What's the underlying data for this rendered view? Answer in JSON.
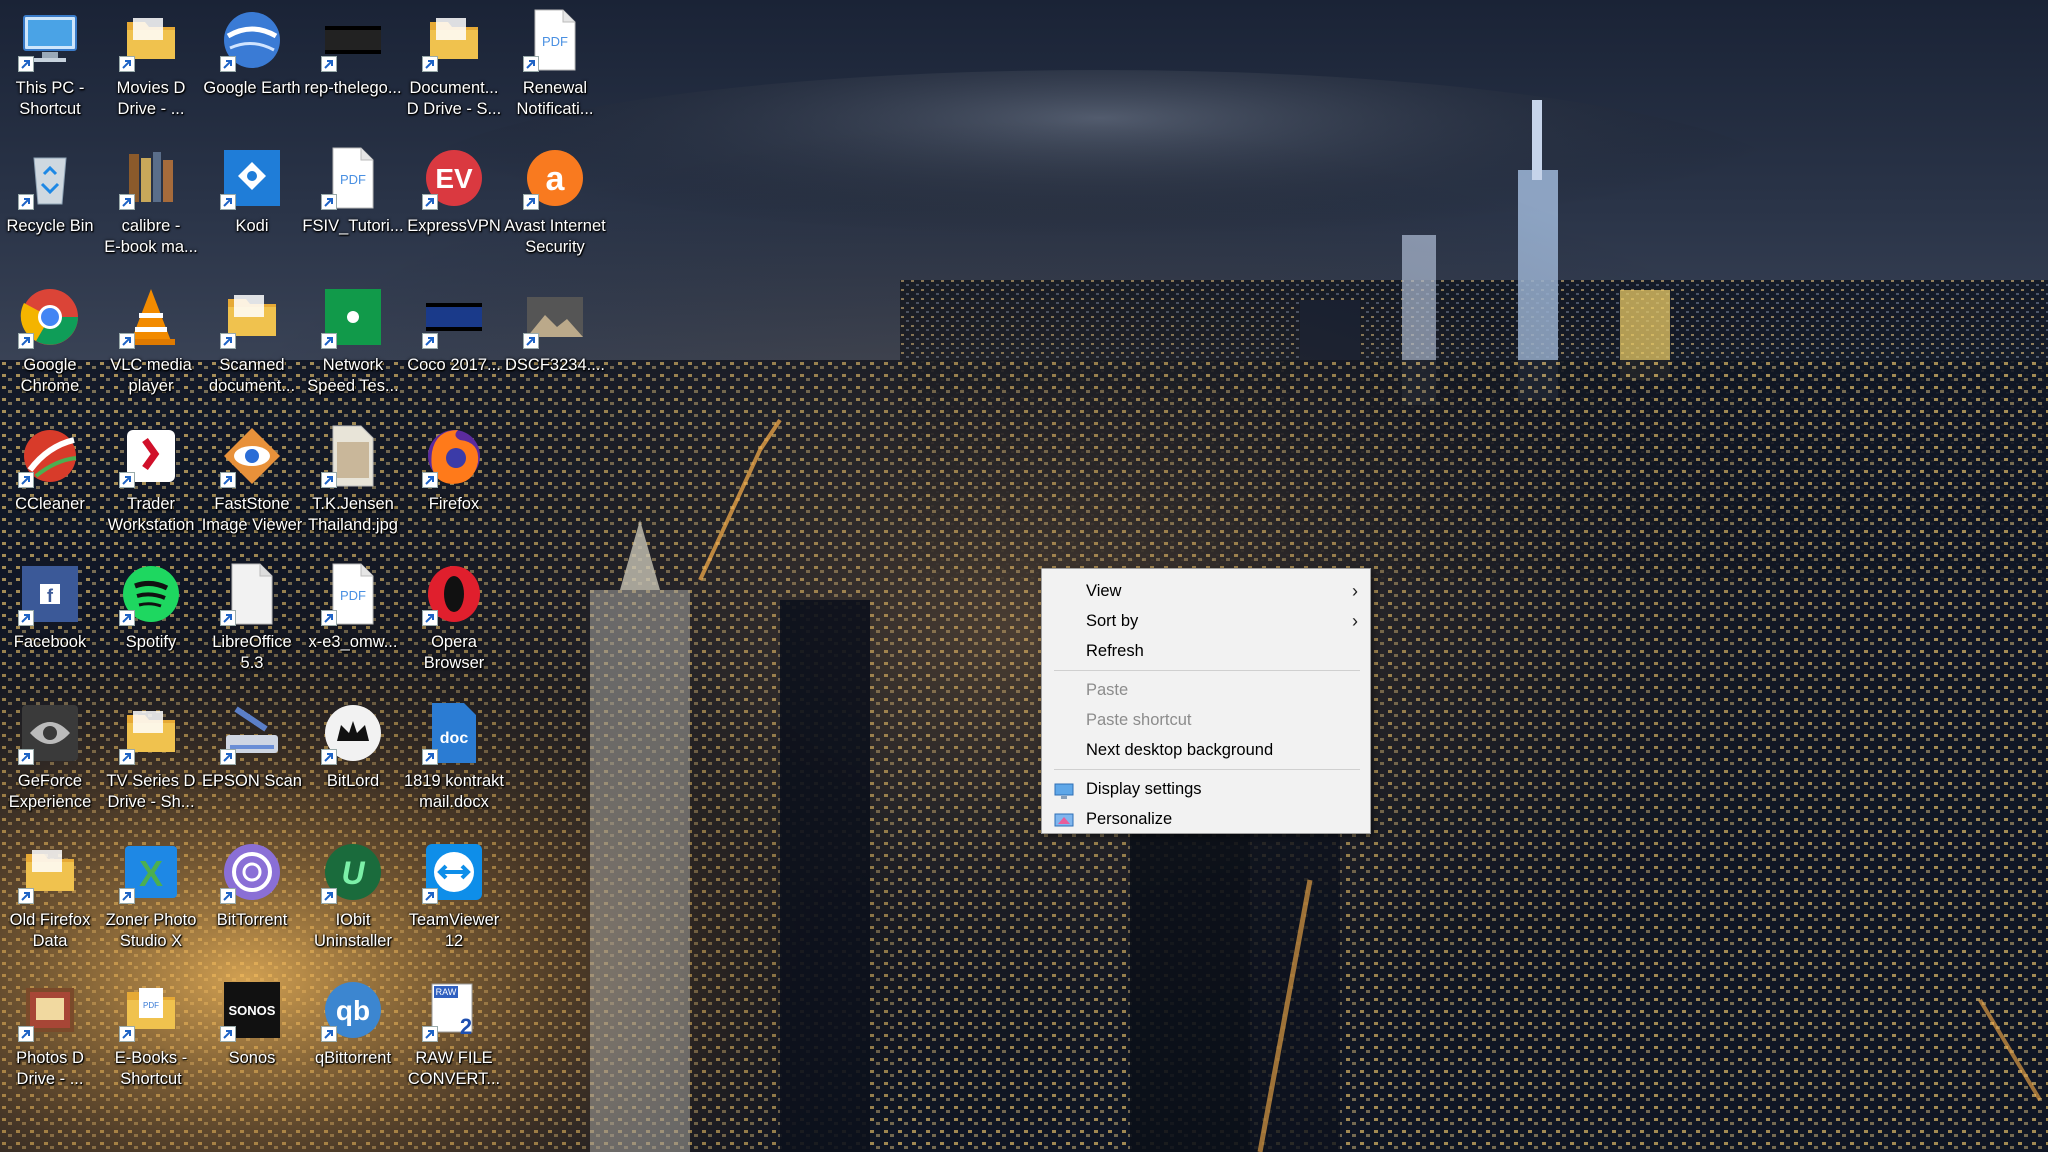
{
  "desktop": {
    "icons": [
      {
        "id": "this-pc",
        "label": "This PC -\nShortcut",
        "icon": "computer-icon",
        "color": "#4aa3e6"
      },
      {
        "id": "movies-d-drive",
        "label": "Movies D\nDrive - ...",
        "icon": "folder-icon",
        "color": "#f0c24e"
      },
      {
        "id": "google-earth",
        "label": "Google Earth",
        "icon": "google-earth-icon",
        "color": "#3a7bd5"
      },
      {
        "id": "rep-thelego",
        "label": "rep-thelego...",
        "icon": "video-thumbnail-icon",
        "color": "#222"
      },
      {
        "id": "documents-d-drive",
        "label": "Document...\nD Drive - S...",
        "icon": "folder-icon",
        "color": "#f0c24e"
      },
      {
        "id": "renewal-notification",
        "label": "Renewal\nNotificati...",
        "icon": "pdf-icon",
        "color": "#ffffff"
      },
      {
        "id": "recycle-bin",
        "label": "Recycle Bin",
        "icon": "recycle-bin-icon",
        "color": "#cfd8e0"
      },
      {
        "id": "calibre",
        "label": "calibre -\nE-book ma...",
        "icon": "calibre-icon",
        "color": "#8b5a2b"
      },
      {
        "id": "kodi",
        "label": "Kodi",
        "icon": "kodi-icon",
        "color": "#1f7dd8"
      },
      {
        "id": "fsiv-tutorial",
        "label": "FSIV_Tutori...",
        "icon": "pdf-icon",
        "color": "#ffffff"
      },
      {
        "id": "expressvpn",
        "label": "ExpressVPN",
        "icon": "expressvpn-icon",
        "color": "#da3940"
      },
      {
        "id": "avast",
        "label": "Avast Internet\nSecurity",
        "icon": "avast-icon",
        "color": "#f97a1f"
      },
      {
        "id": "google-chrome",
        "label": "Google\nChrome",
        "icon": "chrome-icon",
        "color": "#4285f4"
      },
      {
        "id": "vlc",
        "label": "VLC media\nplayer",
        "icon": "vlc-icon",
        "color": "#f28b00"
      },
      {
        "id": "scanned-documents",
        "label": "Scanned\ndocument...",
        "icon": "folder-icon",
        "color": "#f0c24e"
      },
      {
        "id": "network-speed-test",
        "label": "Network\nSpeed Tes...",
        "icon": "speedtest-icon",
        "color": "#119a4a"
      },
      {
        "id": "coco-2017",
        "label": "Coco 2017...",
        "icon": "video-thumbnail-icon",
        "color": "#1a3a8a"
      },
      {
        "id": "dscf3234",
        "label": "DSCF3234....",
        "icon": "photo-thumbnail-icon",
        "color": "#555"
      },
      {
        "id": "ccleaner",
        "label": "CCleaner",
        "icon": "ccleaner-icon",
        "color": "#d83b2a"
      },
      {
        "id": "trader-workstation",
        "label": "Trader\nWorkstation",
        "icon": "trader-workstation-icon",
        "color": "#d0102a"
      },
      {
        "id": "faststone",
        "label": "FastStone\nImage Viewer",
        "icon": "faststone-icon",
        "color": "#e8913a"
      },
      {
        "id": "tk-jensen",
        "label": "T.K.Jensen\nThailand.jpg",
        "icon": "image-file-icon",
        "color": "#e8e4d8"
      },
      {
        "id": "firefox",
        "label": "Firefox",
        "icon": "firefox-icon",
        "color": "#ff7a1a"
      },
      {
        "id": "empty-1",
        "label": "",
        "icon": "",
        "color": ""
      },
      {
        "id": "facebook",
        "label": "Facebook",
        "icon": "facebook-icon",
        "color": "#3b5998"
      },
      {
        "id": "spotify",
        "label": "Spotify",
        "icon": "spotify-icon",
        "color": "#1ed760"
      },
      {
        "id": "libreoffice",
        "label": "LibreOffice\n5.3",
        "icon": "document-icon",
        "color": "#f2f2f2"
      },
      {
        "id": "x-e3-omw",
        "label": "x-e3_omw...",
        "icon": "pdf-icon",
        "color": "#ffffff"
      },
      {
        "id": "opera",
        "label": "Opera\nBrowser",
        "icon": "opera-icon",
        "color": "#e01f2d"
      },
      {
        "id": "empty-2",
        "label": "",
        "icon": "",
        "color": ""
      },
      {
        "id": "geforce-experience",
        "label": "GeForce\nExperience",
        "icon": "geforce-icon",
        "color": "#3a3a3a"
      },
      {
        "id": "tv-series",
        "label": "TV Series D\nDrive - Sh...",
        "icon": "folder-icon",
        "color": "#f0c24e"
      },
      {
        "id": "epson-scan",
        "label": "EPSON Scan",
        "icon": "scanner-icon",
        "color": "#5b7fc8"
      },
      {
        "id": "bitlord",
        "label": "BitLord",
        "icon": "bitlord-icon",
        "color": "#f2f2f2"
      },
      {
        "id": "kontrakt-docx",
        "label": "1819 kontrakt\nmail.docx",
        "icon": "docx-icon",
        "color": "#2b7cd3"
      },
      {
        "id": "empty-3",
        "label": "",
        "icon": "",
        "color": ""
      },
      {
        "id": "old-firefox-data",
        "label": "Old Firefox\nData",
        "icon": "folder-icon",
        "color": "#f0c24e"
      },
      {
        "id": "zoner-photo-studio",
        "label": "Zoner Photo\nStudio X",
        "icon": "zoner-icon",
        "color": "#4caf50"
      },
      {
        "id": "bittorrent",
        "label": "BitTorrent",
        "icon": "bittorrent-icon",
        "color": "#8a6fd6"
      },
      {
        "id": "iobit-uninstaller",
        "label": "IObit\nUninstaller",
        "icon": "iobit-icon",
        "color": "#1a6b3c"
      },
      {
        "id": "teamviewer",
        "label": "TeamViewer\n12",
        "icon": "teamviewer-icon",
        "color": "#0e8ee9"
      },
      {
        "id": "empty-4",
        "label": "",
        "icon": "",
        "color": ""
      },
      {
        "id": "photos-d-drive",
        "label": "Photos D\nDrive - ...",
        "icon": "photo-folder-icon",
        "color": "#7a4a2a"
      },
      {
        "id": "e-books-shortcut",
        "label": "E-Books -\nShortcut",
        "icon": "folder-pdf-icon",
        "color": "#f0c24e"
      },
      {
        "id": "sonos",
        "label": "Sonos",
        "icon": "sonos-icon",
        "color": "#111"
      },
      {
        "id": "qbittorrent",
        "label": "qBittorrent",
        "icon": "qbittorrent-icon",
        "color": "#3c86d0"
      },
      {
        "id": "raw-file-converter",
        "label": "RAW FILE\nCONVERT...",
        "icon": "raw-converter-icon",
        "color": "#3060c0"
      },
      {
        "id": "empty-5",
        "label": "",
        "icon": "",
        "color": ""
      }
    ]
  },
  "context_menu": {
    "items": [
      {
        "type": "item",
        "name": "view",
        "label": "View",
        "submenu": true,
        "disabled": false,
        "icon": ""
      },
      {
        "type": "item",
        "name": "sort-by",
        "label": "Sort by",
        "submenu": true,
        "disabled": false,
        "icon": ""
      },
      {
        "type": "item",
        "name": "refresh",
        "label": "Refresh",
        "submenu": false,
        "disabled": false,
        "icon": ""
      },
      {
        "type": "separator"
      },
      {
        "type": "item",
        "name": "paste",
        "label": "Paste",
        "submenu": false,
        "disabled": true,
        "icon": ""
      },
      {
        "type": "item",
        "name": "paste-shortcut",
        "label": "Paste shortcut",
        "submenu": false,
        "disabled": true,
        "icon": ""
      },
      {
        "type": "item",
        "name": "next-desktop-background",
        "label": "Next desktop background",
        "submenu": false,
        "disabled": false,
        "icon": ""
      },
      {
        "type": "separator"
      },
      {
        "type": "item",
        "name": "display-settings",
        "label": "Display settings",
        "submenu": false,
        "disabled": false,
        "icon": "display-settings-icon"
      },
      {
        "type": "item",
        "name": "personalize",
        "label": "Personalize",
        "submenu": false,
        "disabled": false,
        "icon": "personalize-icon"
      }
    ]
  }
}
